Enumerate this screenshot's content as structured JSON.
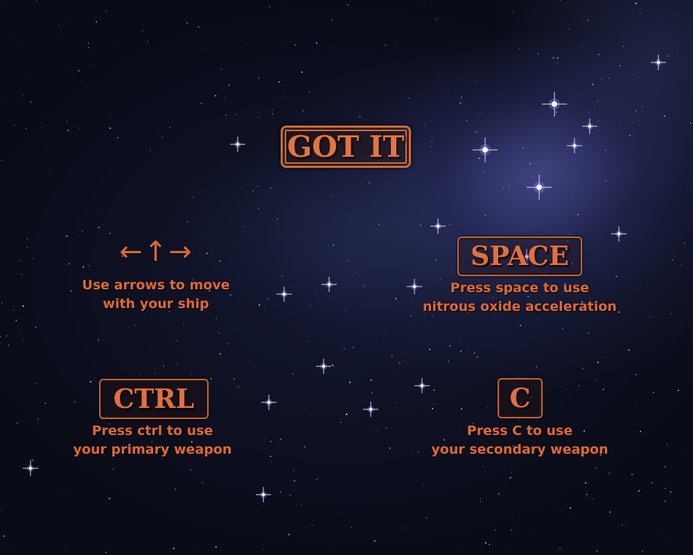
{
  "screen": {
    "got_it_label": "GOT IT",
    "accent_color": "#d96a38"
  },
  "controls": {
    "move": {
      "keys": "←↑→",
      "line1": "Use arrows to move",
      "line2": "with your ship"
    },
    "space": {
      "key": "SPACE",
      "line1": "Press space to use",
      "line2": "nitrous oxide acceleration"
    },
    "ctrl": {
      "key": "CTRL",
      "line1": "Press ctrl to use",
      "line2": "your primary weapon"
    },
    "c": {
      "key": "C",
      "line1": "Press C to use",
      "line2": "your secondary weapon"
    }
  }
}
